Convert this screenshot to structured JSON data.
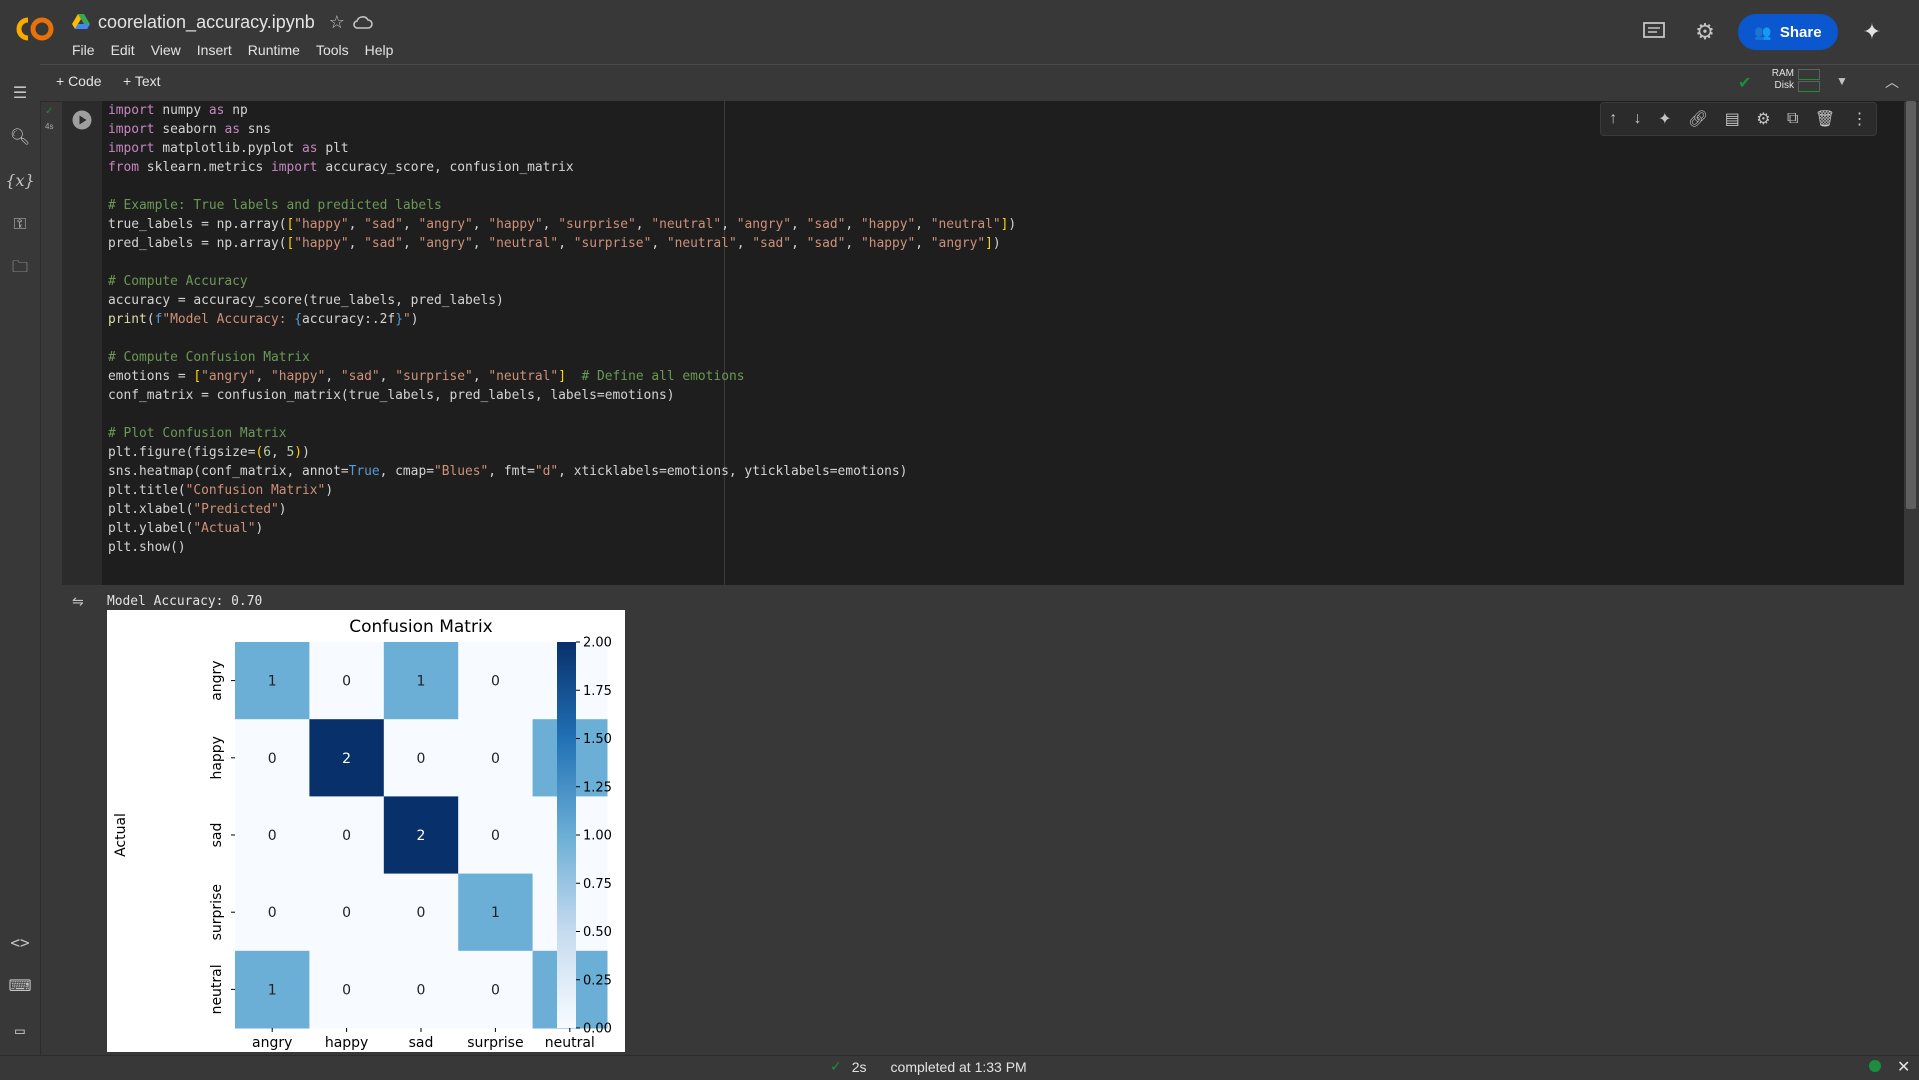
{
  "app": {
    "doc_title": "coorelation_accuracy.ipynb",
    "menu": [
      "File",
      "Edit",
      "View",
      "Insert",
      "Runtime",
      "Tools",
      "Help"
    ],
    "share_label": "Share"
  },
  "toolbar": {
    "add_code_label": "+ Code",
    "add_text_label": "+ Text",
    "ram_label": "RAM",
    "disk_label": "Disk"
  },
  "cell": {
    "exec_time": "4s",
    "code_lines": [
      "import numpy as np",
      "import seaborn as sns",
      "import matplotlib.pyplot as plt",
      "from sklearn.metrics import accuracy_score, confusion_matrix",
      "",
      "# Example: True labels and predicted labels",
      "true_labels = np.array([\"happy\", \"sad\", \"angry\", \"happy\", \"surprise\", \"neutral\", \"angry\", \"sad\", \"happy\", \"neutral\"])",
      "pred_labels = np.array([\"happy\", \"sad\", \"angry\", \"neutral\", \"surprise\", \"neutral\", \"sad\", \"sad\", \"happy\", \"angry\"])",
      "",
      "# Compute Accuracy",
      "accuracy = accuracy_score(true_labels, pred_labels)",
      "print(f\"Model Accuracy: {accuracy:.2f}\")",
      "",
      "# Compute Confusion Matrix",
      "emotions = [\"angry\", \"happy\", \"sad\", \"surprise\", \"neutral\"]  # Define all emotions",
      "conf_matrix = confusion_matrix(true_labels, pred_labels, labels=emotions)",
      "",
      "# Plot Confusion Matrix",
      "plt.figure(figsize=(6, 5))",
      "sns.heatmap(conf_matrix, annot=True, cmap=\"Blues\", fmt=\"d\", xticklabels=emotions, yticklabels=emotions)",
      "plt.title(\"Confusion Matrix\")",
      "plt.xlabel(\"Predicted\")",
      "plt.ylabel(\"Actual\")",
      "plt.show()"
    ],
    "output_text": "Model Accuracy: 0.70"
  },
  "chart_data": {
    "type": "heatmap",
    "title": "Confusion Matrix",
    "xlabel": "",
    "ylabel": "Actual",
    "x_categories": [
      "angry",
      "happy",
      "sad",
      "surprise",
      "neutral"
    ],
    "y_categories": [
      "angry",
      "happy",
      "sad",
      "surprise",
      "neutral"
    ],
    "values": [
      [
        1,
        0,
        1,
        0,
        0
      ],
      [
        0,
        2,
        0,
        0,
        1
      ],
      [
        0,
        0,
        2,
        0,
        0
      ],
      [
        0,
        0,
        0,
        1,
        0
      ],
      [
        1,
        0,
        0,
        0,
        1
      ]
    ],
    "colorbar_ticks": [
      "2.00",
      "1.75",
      "1.50",
      "1.25",
      "1.00",
      "0.75",
      "0.50",
      "0.25",
      "0.00"
    ],
    "vmin": 0,
    "vmax": 2,
    "cmap": "Blues"
  },
  "status": {
    "duration": "2s",
    "message": "completed at 1:33 PM"
  },
  "colors": {
    "accent": "#0b57d0",
    "logo_orange": "#f9ab00",
    "status_green": "#1e8e3e"
  }
}
